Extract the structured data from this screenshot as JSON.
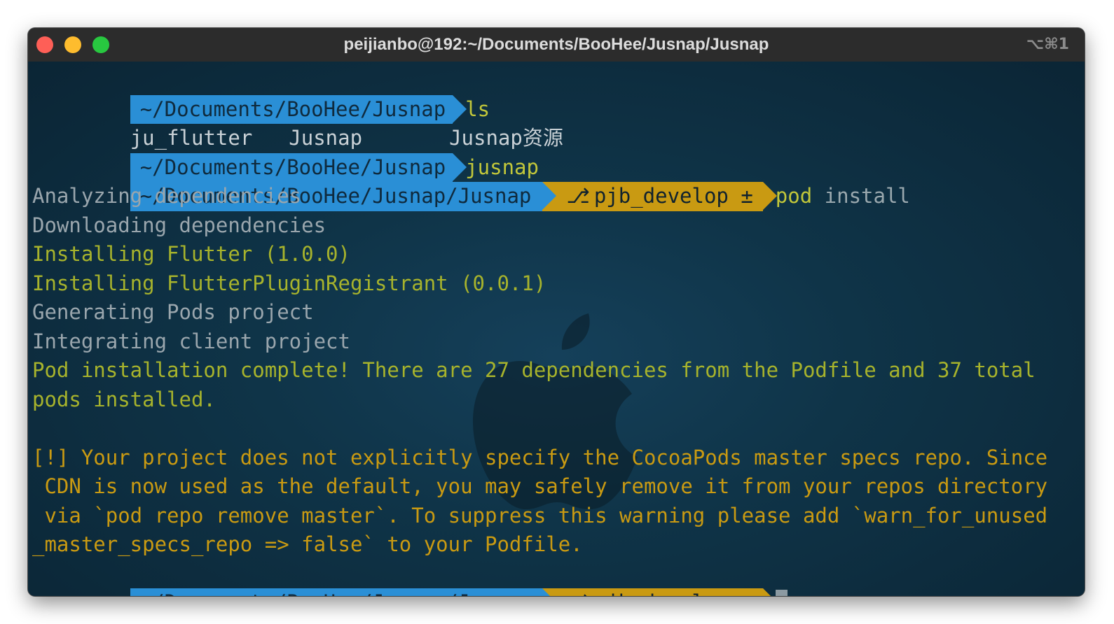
{
  "window": {
    "title": "peijianbo@192:~/Documents/BooHee/Jusnap/Jusnap",
    "shortcut": "⌥⌘1"
  },
  "terminal": {
    "prompt1": {
      "path": "~/Documents/BooHee/Jusnap",
      "command": "ls"
    },
    "ls_output": {
      "item1": "ju_flutter",
      "item2": "Jusnap",
      "item3": "Jusnap资源"
    },
    "prompt2": {
      "path": "~/Documents/BooHee/Jusnap",
      "command": "jusnap"
    },
    "prompt3": {
      "path": "~/Documents/BooHee/Jusnap/Jusnap",
      "branch": "pjb_develop ±",
      "command_word": "pod",
      "command_arg": "install"
    },
    "output": [
      "Analyzing dependencies",
      "Downloading dependencies",
      "Installing Flutter (1.0.0)",
      "Installing FlutterPluginRegistrant (0.0.1)",
      "Generating Pods project",
      "Integrating client project",
      "Pod installation complete! There are 27 dependencies from the Podfile and 37 total",
      "pods installed."
    ],
    "warning": [
      "[!] Your project does not explicitly specify the CocoaPods master specs repo. Since",
      " CDN is now used as the default, you may safely remove it from your repos directory",
      " via `pod repo remove master`. To suppress this warning please add `warn_for_unused",
      "_master_specs_repo => false` to your Podfile."
    ],
    "prompt4": {
      "path": "~/Documents/BooHee/Jusnap/Jusnap",
      "branch": "pjb_develop ±"
    }
  },
  "colors": {
    "path_segment": "#2a8fd6",
    "git_segment": "#c99a12",
    "success_text": "#a7b32c",
    "warning_text": "#c99a12",
    "info_text": "#9aa6ad"
  }
}
